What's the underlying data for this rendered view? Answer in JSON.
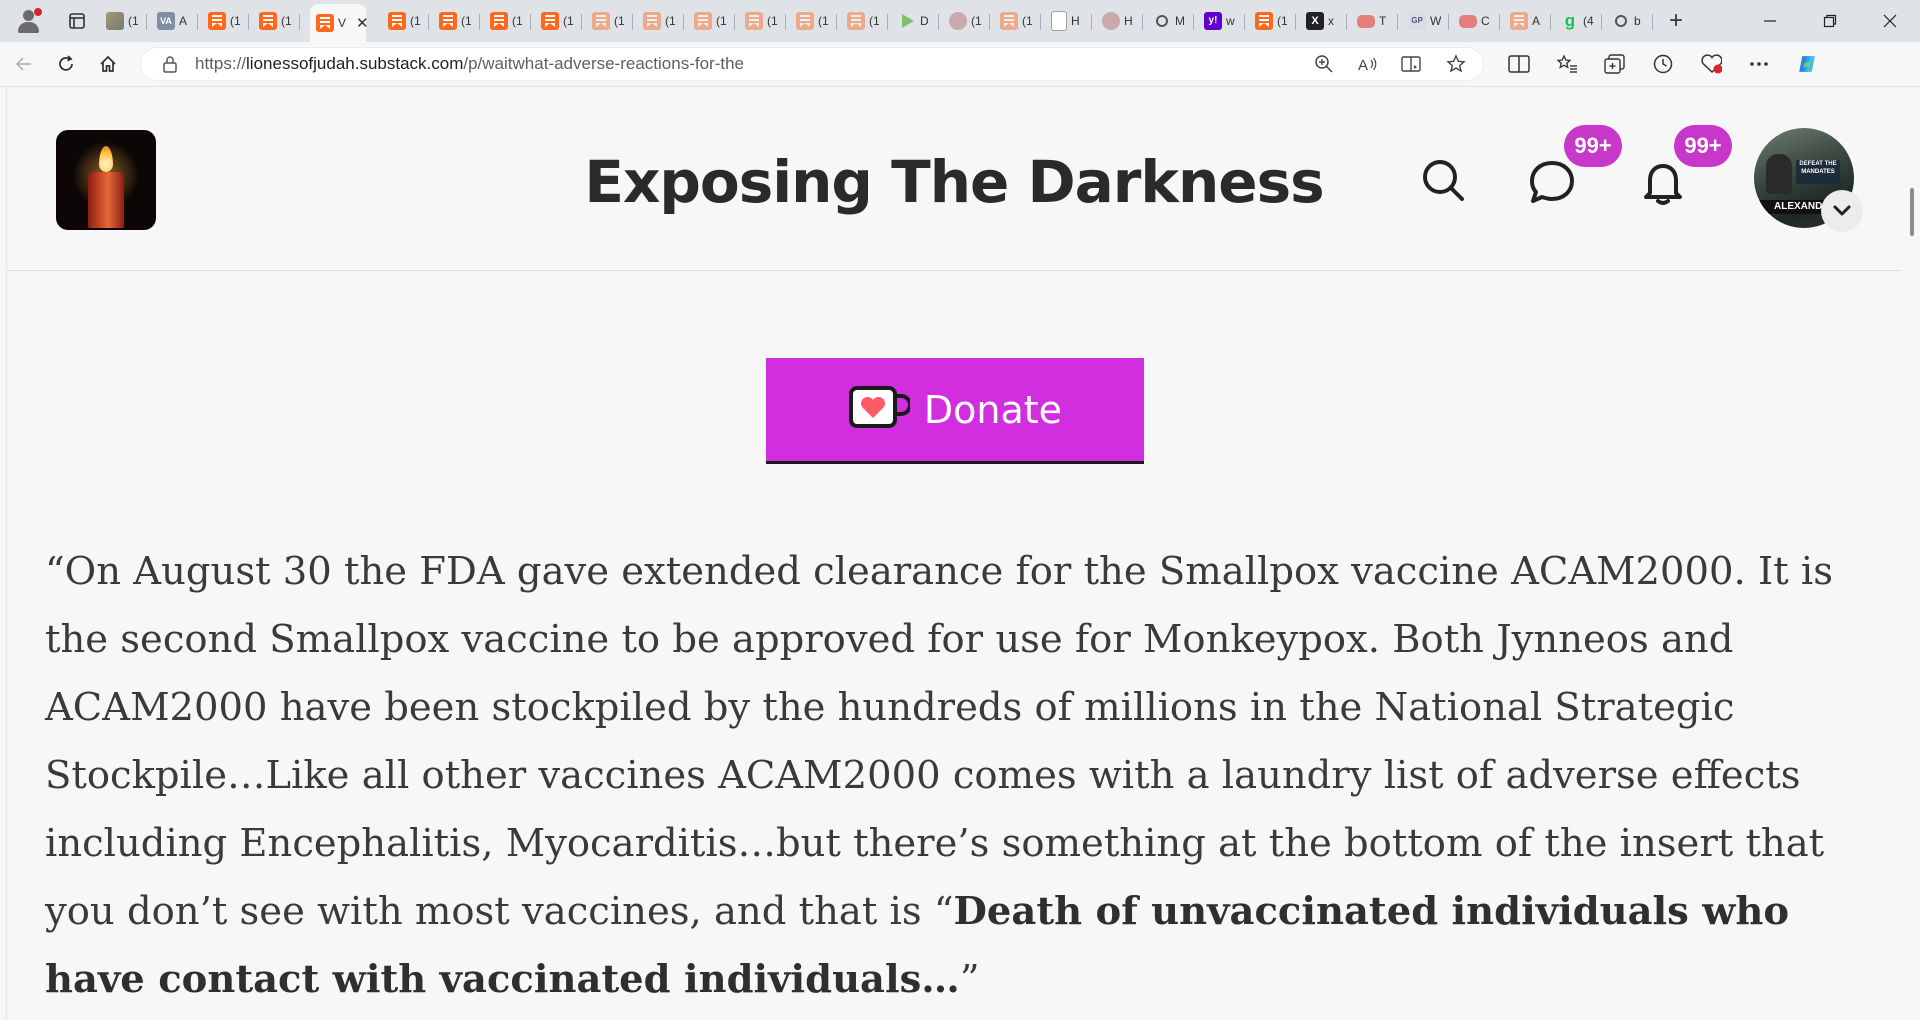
{
  "browser": {
    "tabs": [
      {
        "icon": "image-thumb",
        "letter": "(1"
      },
      {
        "icon": "va-logo",
        "letter": "A"
      },
      {
        "icon": "substack-icon",
        "letter": "(1"
      },
      {
        "icon": "substack-icon",
        "letter": "(1"
      },
      {
        "icon": "substack-icon",
        "letter": "V",
        "active": true
      },
      {
        "icon": "substack-icon",
        "letter": "(1"
      },
      {
        "icon": "substack-icon",
        "letter": "(1"
      },
      {
        "icon": "substack-icon",
        "letter": "(1"
      },
      {
        "icon": "substack-icon",
        "letter": "(1"
      },
      {
        "icon": "substack-icon-faded",
        "letter": "(1"
      },
      {
        "icon": "substack-icon-faded",
        "letter": "(1"
      },
      {
        "icon": "substack-icon-faded",
        "letter": "(1"
      },
      {
        "icon": "substack-icon-faded",
        "letter": "(1"
      },
      {
        "icon": "substack-icon-faded",
        "letter": "(1"
      },
      {
        "icon": "substack-icon-faded",
        "letter": "(1"
      },
      {
        "icon": "play-icon",
        "letter": "D"
      },
      {
        "icon": "person-icon",
        "letter": "(1"
      },
      {
        "icon": "substack-icon-faded",
        "letter": "(1"
      },
      {
        "icon": "document-icon",
        "letter": "H"
      },
      {
        "icon": "person-icon",
        "letter": "H"
      },
      {
        "icon": "search-icon",
        "letter": "M"
      },
      {
        "icon": "yahoo-icon",
        "letter": "w"
      },
      {
        "icon": "substack-icon",
        "letter": "(1"
      },
      {
        "icon": "x-icon",
        "letter": "x"
      },
      {
        "icon": "youtube-icon",
        "letter": "T"
      },
      {
        "icon": "gp-icon",
        "letter": "W"
      },
      {
        "icon": "youtube-icon",
        "letter": "C"
      },
      {
        "icon": "substack-icon-faded",
        "letter": "A"
      },
      {
        "icon": "g-icon",
        "letter": "(4"
      },
      {
        "icon": "search-icon",
        "letter": "b"
      }
    ],
    "url_prefix": "https://",
    "url_host": "lionessofjudah.substack.com",
    "url_path": "/p/waitwhat-adverse-reactions-for-the"
  },
  "site": {
    "title": "Exposing The Darkness",
    "chat_badge": "99+",
    "notifications_badge": "99+",
    "avatar_sign_text": "DEFEAT THE MANDATES",
    "avatar_band_text": "ALEXAND"
  },
  "donate": {
    "label": "Donate"
  },
  "article": {
    "paragraph_normal": "“On August 30 the FDA gave extended clearance for the Smallpox vaccine ACAM2000. It is the second Smallpox vaccine to be approved for use for Monkeypox. Both Jynneos and ACAM2000 have been stockpiled by the hundreds of millions in the National Strategic Stockpile…Like all other vaccines ACAM2000 comes with a laundry list of adverse effects including Encephalitis, Myocarditis…but there’s something at the bottom of the insert that you don’t see with most vaccines, and that is “",
    "paragraph_bold": "Death of unvaccinated individuals who have contact with vaccinated individuals…",
    "paragraph_end": "”"
  },
  "colors": {
    "donate_bg": "#d12edf",
    "badge_bg": "#c737c9",
    "substack_orange": "#ff6719"
  }
}
